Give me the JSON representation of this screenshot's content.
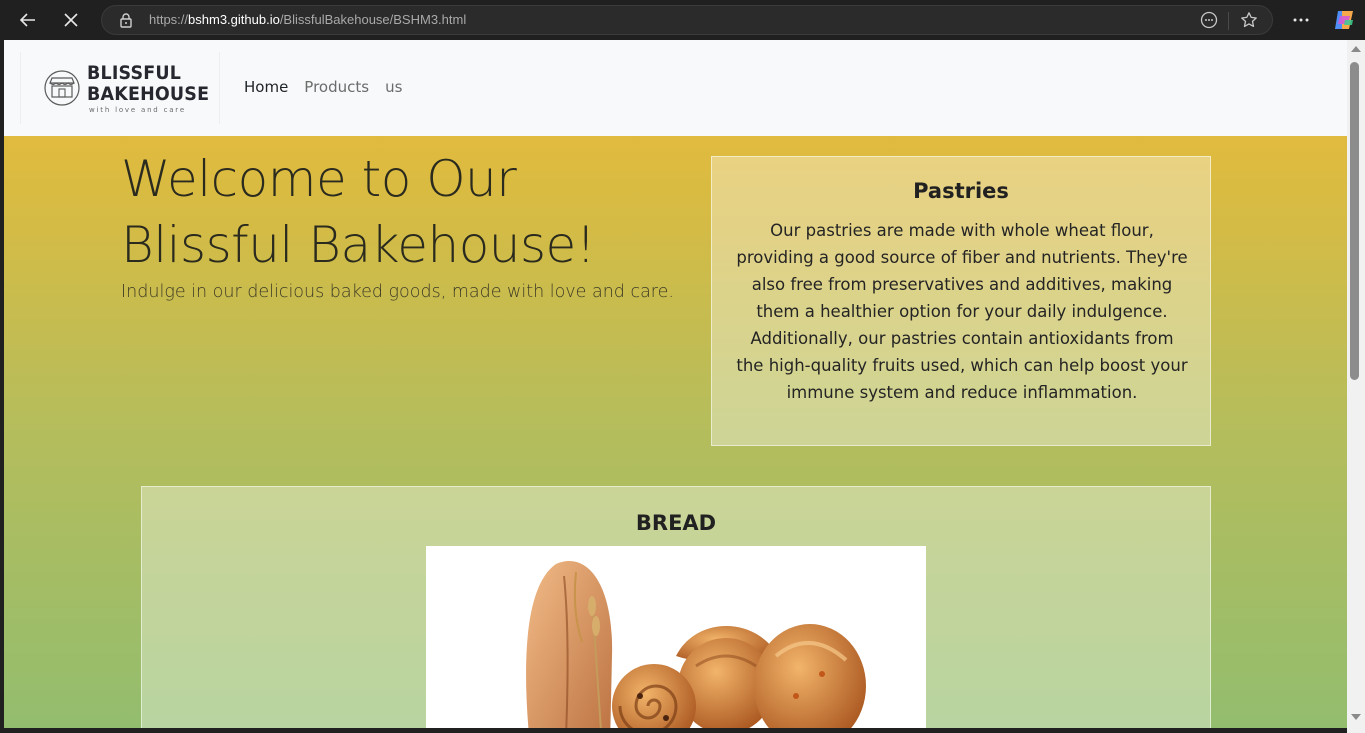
{
  "browser": {
    "url_host": "bshm3.github.io",
    "url_path": "/BlissfulBakehouse/BSHM3.html",
    "url_scheme": "https://",
    "icons": [
      "back-arrow-icon",
      "stop-loading-icon",
      "lock-icon",
      "reader-mode-icon",
      "favorite-star-icon",
      "more-menu-icon",
      "copilot-icon"
    ]
  },
  "site": {
    "logo": {
      "line1": "BLISSFUL",
      "line2": "BAKEHOUSE",
      "tagline": "with love and care"
    },
    "nav": [
      {
        "label": "Home"
      },
      {
        "label": "Products"
      },
      {
        "label": "us"
      }
    ],
    "hero": {
      "title_line1": "Welcome to Our",
      "title_line2": "Blissful Bakehouse!",
      "subtitle": "Indulge in our delicious baked goods, made with love and care."
    },
    "pastries": {
      "title": "Pastries",
      "body": "Our pastries are made with whole wheat flour, providing a good source of fiber and nutrients. They're also free from preservatives and additives, making them a healthier option for your daily indulgence. Additionally, our pastries contain antioxidants from the high-quality fruits used, which can help boost your immune system and reduce inflammation."
    },
    "bread": {
      "title": "BREAD"
    }
  },
  "colors": {
    "gradient_top": "#eeba36",
    "gradient_bottom": "#93bd6e",
    "nav_bg": "#f8f9fa",
    "chrome_bg": "#202020"
  }
}
